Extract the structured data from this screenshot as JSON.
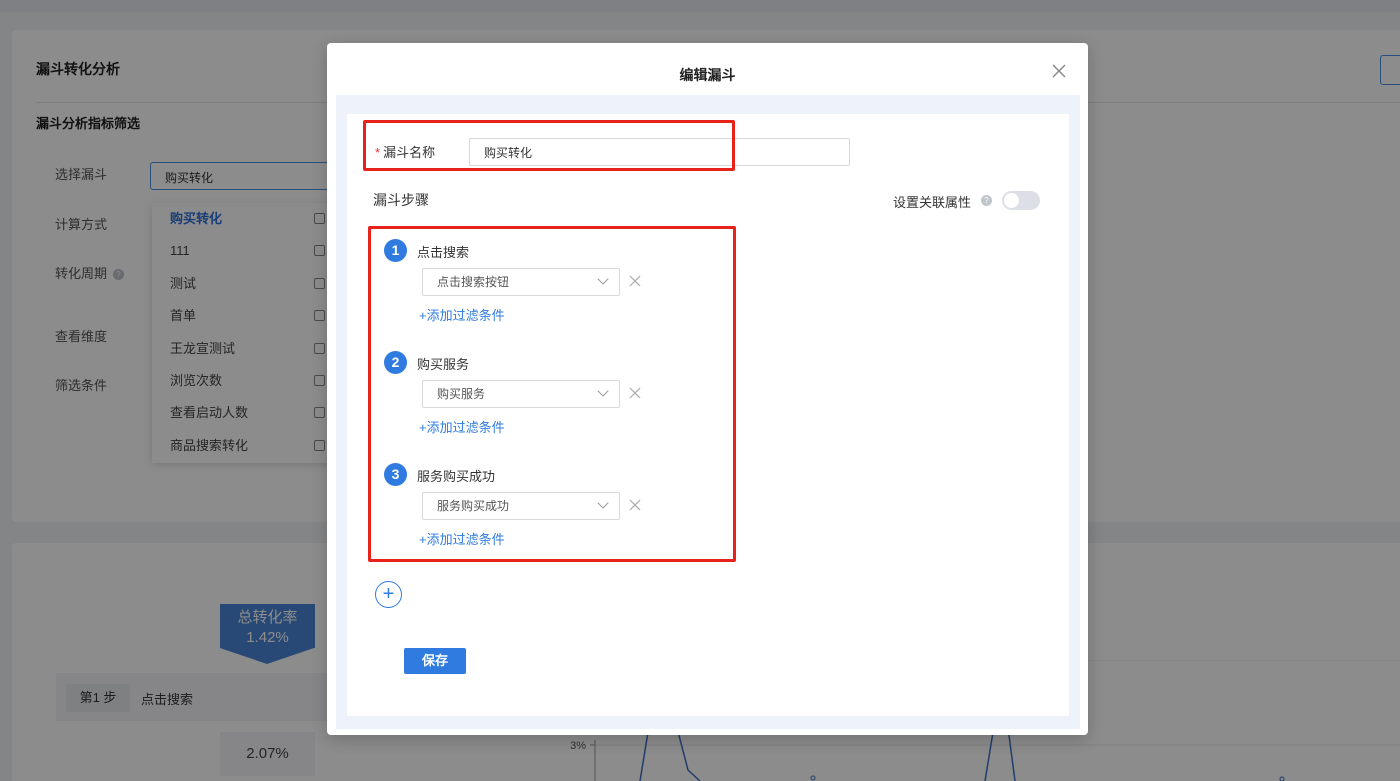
{
  "background": {
    "title": "漏斗转化分析",
    "subtitle": "漏斗分析指标筛选",
    "labels": {
      "select_funnel": "选择漏斗",
      "calc_method": "计算方式",
      "conversion_period": "转化周期",
      "view_dimension": "查看维度",
      "filter_condition": "筛选条件"
    },
    "selected_funnel": "购买转化",
    "dropdown_items": [
      "购买转化",
      "111",
      "测试",
      "首单",
      "王龙宣测试",
      "浏览次数",
      "查看启动人数",
      "商品搜索转化"
    ],
    "total_rate_label": "总转化率",
    "total_rate_value": "1.42%",
    "step_tag": "第1 步",
    "step_name": "点击搜索",
    "step_pct": "2.07%",
    "chart_tick": "3%"
  },
  "modal": {
    "title": "编辑漏斗",
    "funnel_name_label": "漏斗名称",
    "funnel_name_value": "购买转化",
    "steps_label": "漏斗步骤",
    "assoc_attr_label": "设置关联属性",
    "assoc_attr_enabled": false,
    "steps": [
      {
        "num": "1",
        "name": "点击搜索",
        "event": "点击搜索按钮",
        "add_filter": "+添加过滤条件"
      },
      {
        "num": "2",
        "name": "购买服务",
        "event": "购买服务",
        "add_filter": "+添加过滤条件"
      },
      {
        "num": "3",
        "name": "服务购买成功",
        "event": "服务购买成功",
        "add_filter": "+添加过滤条件"
      }
    ],
    "add_step": "+",
    "save_label": "保存"
  },
  "colors": {
    "accent": "#2f7be0",
    "highlight": "#e6221b"
  }
}
